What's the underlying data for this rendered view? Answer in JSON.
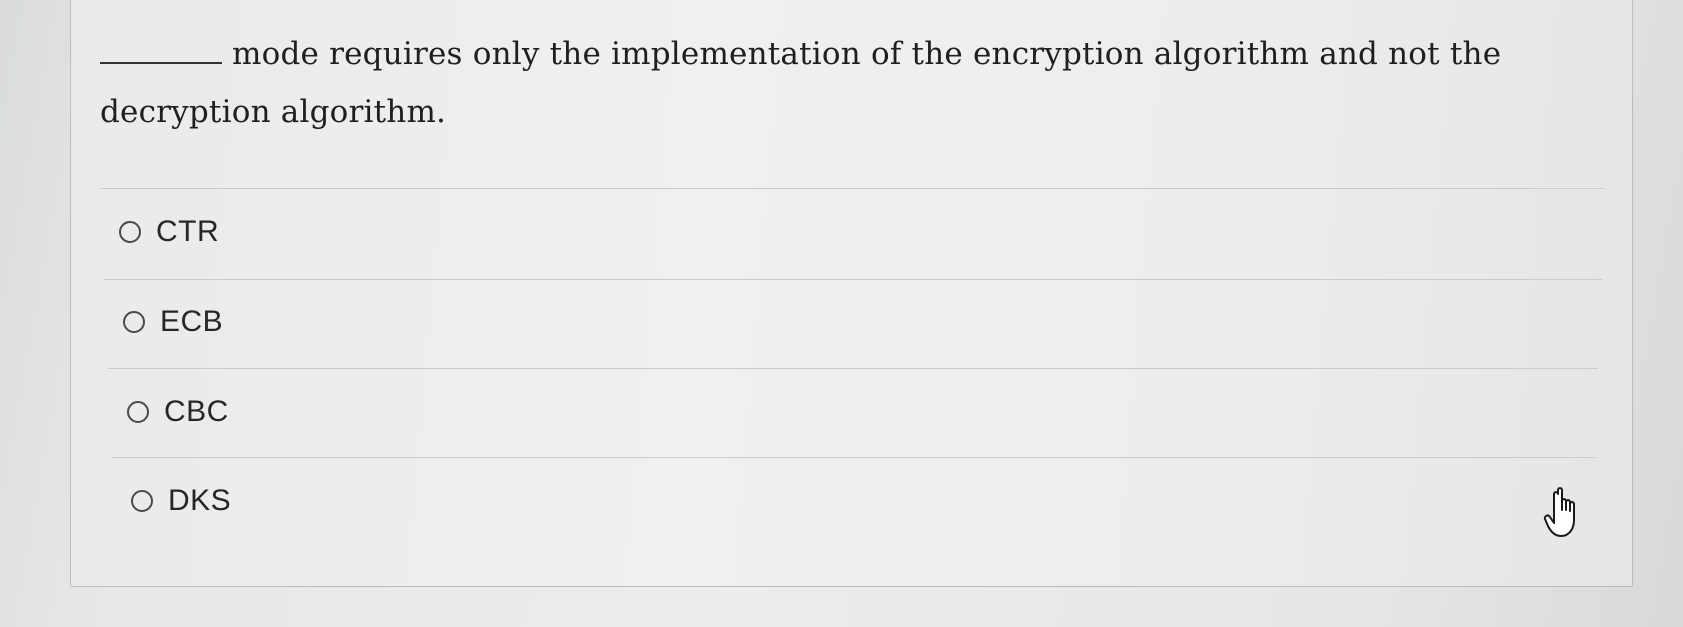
{
  "question": {
    "text_after_blank": "mode requires only the implementation of the encryption algorithm and not the decryption algorithm."
  },
  "options": [
    {
      "label": "CTR",
      "selected": false
    },
    {
      "label": "ECB",
      "selected": false
    },
    {
      "label": "CBC",
      "selected": false
    },
    {
      "label": "DKS",
      "selected": false
    }
  ],
  "cursor": {
    "icon": "pointing-hand-cursor-icon"
  }
}
